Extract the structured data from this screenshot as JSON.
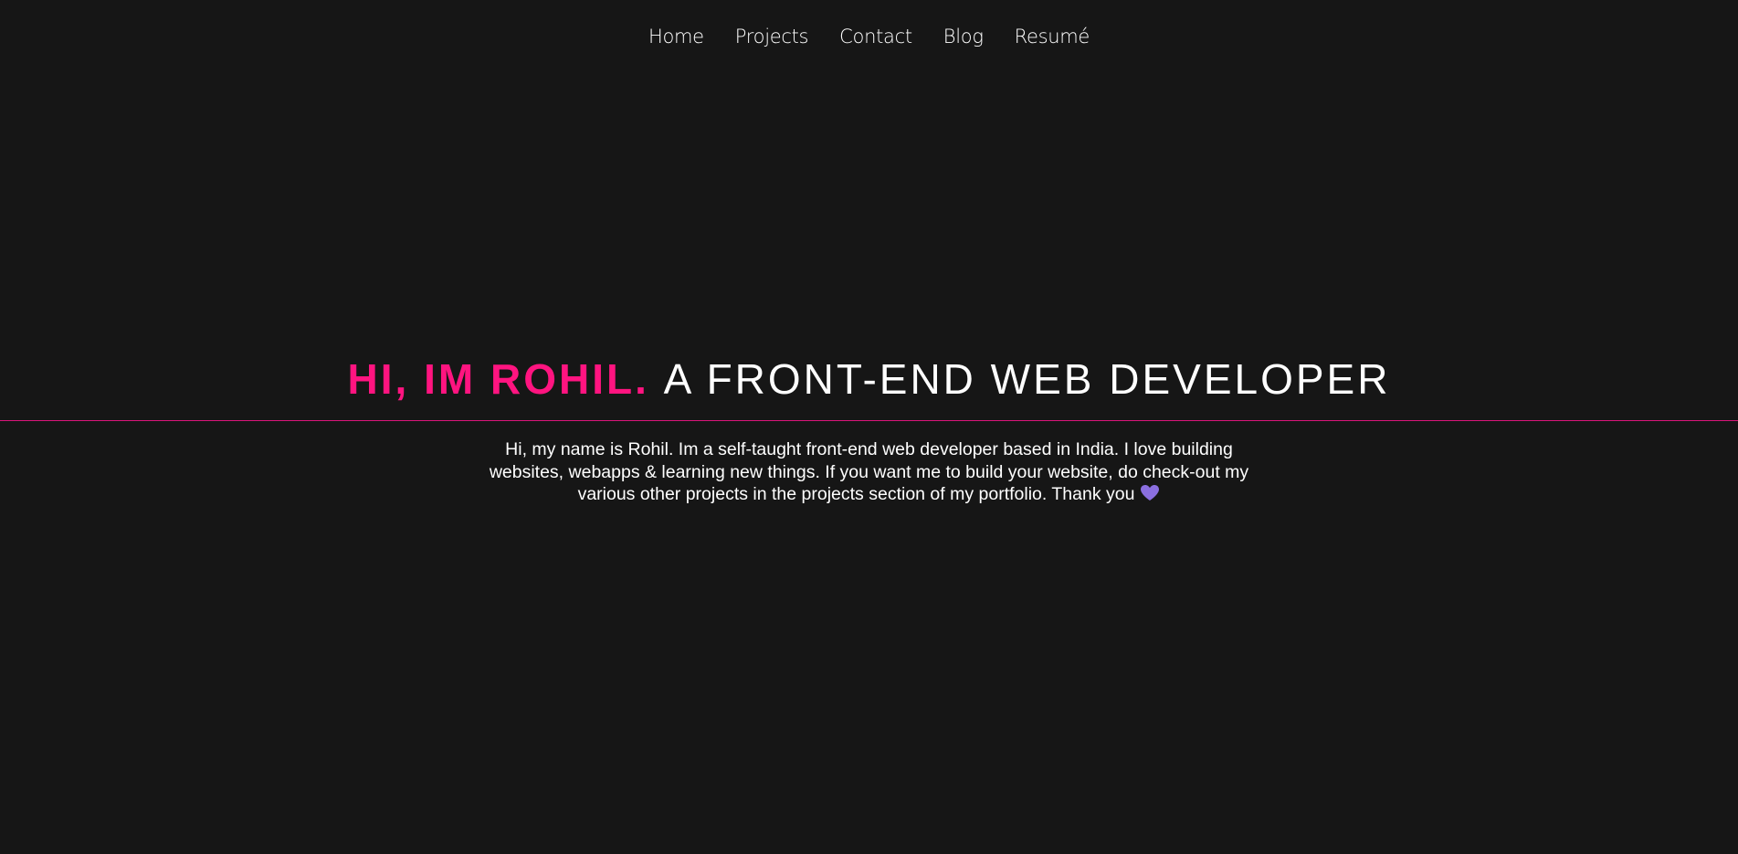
{
  "nav": {
    "items": [
      {
        "label": "Home"
      },
      {
        "label": "Projects"
      },
      {
        "label": "Contact"
      },
      {
        "label": "Blog"
      },
      {
        "label": "Resumé"
      }
    ]
  },
  "hero": {
    "name": "HI, IM ROHIL.",
    "role": "A FRONT-END WEB DEVELOPER",
    "intro": "Hi, my name is Rohil. Im a self-taught front-end web developer based in India. I love building websites, webapps & learning new things. If you want me to build your website, do check-out my various other projects in the projects section of my portfolio. Thank you",
    "heart_icon": "purple-heart-icon"
  },
  "colors": {
    "background": "#161616",
    "accent": "#ff1480",
    "divider": "#d9157a",
    "heart": "#8b6fe0"
  }
}
